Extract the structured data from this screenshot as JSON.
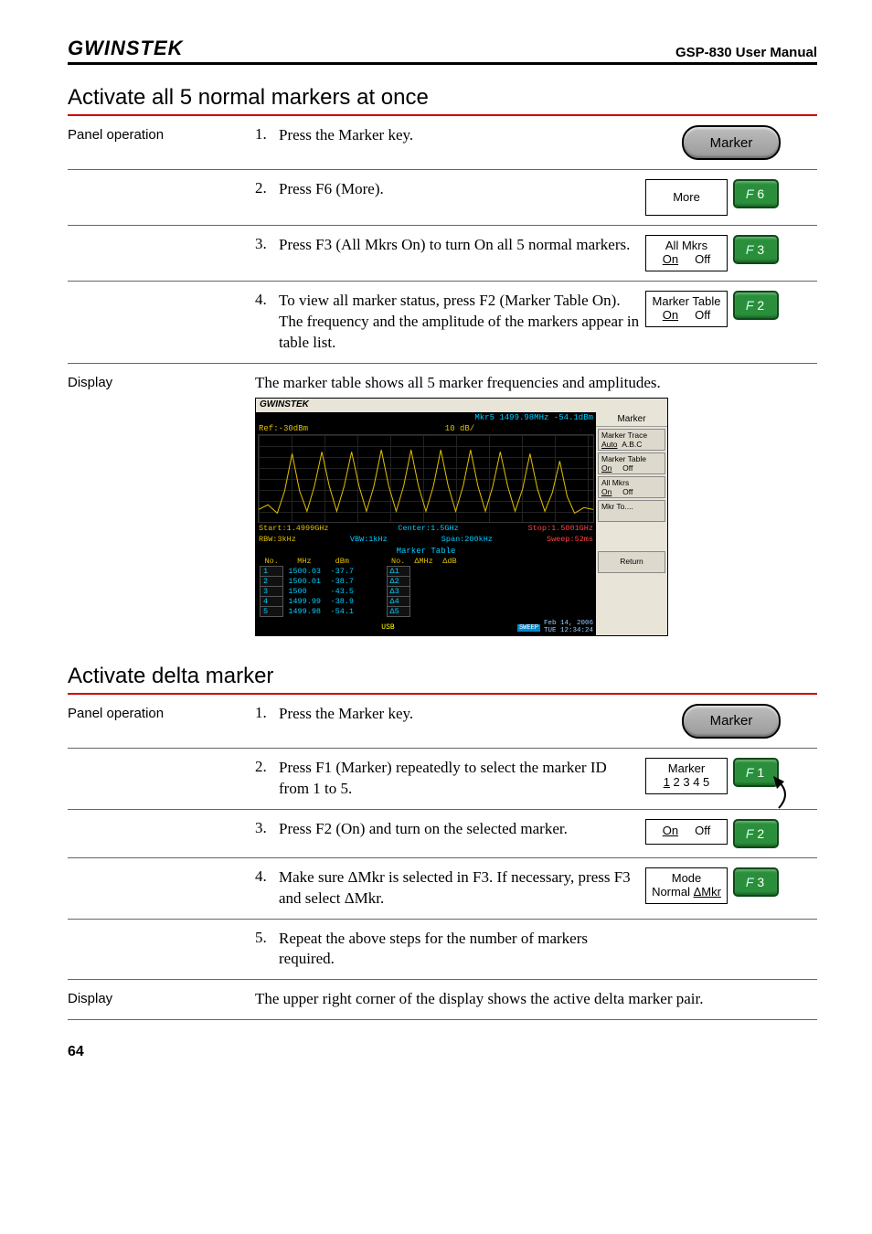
{
  "header": {
    "brand": "GWINSTEK",
    "manual_title": "GSP-830 User Manual"
  },
  "section1": {
    "heading": "Activate all 5 normal markers at once",
    "panel_label": "Panel operation",
    "steps": [
      {
        "num": "1.",
        "text": "Press the Marker key.",
        "key": {
          "type": "hardkey",
          "label": "Marker"
        }
      },
      {
        "num": "2.",
        "text": "Press F6 (More).",
        "key": {
          "type": "softbox",
          "line1": "More",
          "fkey": "6"
        }
      },
      {
        "num": "3.",
        "text": "Press F3 (All Mkrs On) to turn On all 5 normal markers.",
        "key": {
          "type": "softbox",
          "line1": "All Mkrs",
          "line2_on": "On",
          "line2_off": "Off",
          "fkey": "3"
        }
      },
      {
        "num": "4.",
        "text": "To view all marker status, press F2 (Marker Table On). The frequency and the amplitude of the markers appear in table list.",
        "key": {
          "type": "softbox",
          "line1": "Marker Table",
          "line2_on": "On",
          "line2_off": "Off",
          "fkey": "2"
        }
      }
    ],
    "display_label": "Display",
    "display_text": "The marker table shows all 5 marker frequencies and amplitudes.",
    "screenshot": {
      "brand": "GWINSTEK",
      "mkr_info": "Mkr5 1499.98MHz -54.1dBm",
      "ref": "Ref:-30dBm",
      "scale": "10 dB/",
      "side_title": "Marker",
      "side_buttons": [
        {
          "l1": "Marker Trace",
          "l2a": "Auto",
          "l2b": "A.B.C",
          "u": "a"
        },
        {
          "l1": "Marker Table",
          "l2a": "On",
          "l2b": "Off",
          "u": "a"
        },
        {
          "l1": "All        Mkrs",
          "l2a": "On",
          "l2b": "Off",
          "u": "a"
        },
        {
          "l1": "Mkr To....",
          "l2a": "",
          "l2b": ""
        }
      ],
      "return_btn": "Return",
      "freq": {
        "start": "Start:1.4999GHz",
        "center": "Center:1.5GHz",
        "stop": "Stop:1.5001GHz",
        "rbw": "RBW:3kHz",
        "vbw": "VBW:1kHz",
        "span": "Span:200kHz",
        "sweep": "Sweep:52ms"
      },
      "table_title": "Marker Table",
      "table_headers_l": [
        "No.",
        "MHz",
        "dBm"
      ],
      "table_headers_r": [
        "No.",
        "ΔMHz",
        "ΔdB"
      ],
      "table_left": [
        [
          "1",
          "1500.03",
          "-37.7"
        ],
        [
          "2",
          "1500.01",
          "-38.7"
        ],
        [
          "3",
          "1500",
          "-43.5"
        ],
        [
          "4",
          "1499.99",
          "-38.9"
        ],
        [
          "5",
          "1499.98",
          "-54.1"
        ]
      ],
      "table_right": [
        "Δ1",
        "Δ2",
        "Δ3",
        "Δ4",
        "Δ5"
      ],
      "status_usb": "USB",
      "status_sweep": "SWEEP",
      "status_date_l1": "Feb 14, 2006",
      "status_date_l2": "TUE 12:34:24"
    }
  },
  "section2": {
    "heading": "Activate delta marker",
    "panel_label": "Panel operation",
    "steps": [
      {
        "num": "1.",
        "text": "Press the Marker key.",
        "key": {
          "type": "hardkey",
          "label": "Marker"
        }
      },
      {
        "num": "2.",
        "text": "Press F1 (Marker) repeatedly to select the marker ID from 1 to 5.",
        "key": {
          "type": "softbox",
          "line1": "Marker",
          "line2_plain": "1 2 3 4 5",
          "u1": true,
          "fkey": "1",
          "pointer": true
        }
      },
      {
        "num": "3.",
        "text": "Press F2 (On) and turn on the selected marker.",
        "key": {
          "type": "softbox",
          "line1": "",
          "line2_on": "On",
          "line2_off": "Off",
          "single": true,
          "fkey": "2"
        }
      },
      {
        "num": "4.",
        "text": "Make sure ΔMkr is selected in F3. If necessary, press F3 and select ΔMkr.",
        "key": {
          "type": "softbox",
          "line1": "Mode",
          "line2_u": "Normal ΔMkr",
          "fkey": "3"
        }
      },
      {
        "num": "5.",
        "text": "Repeat the above steps for the number of markers required.",
        "key": null
      }
    ],
    "display_label": "Display",
    "display_text": "The upper right corner of the display shows the active delta marker pair."
  },
  "page_number": "64"
}
